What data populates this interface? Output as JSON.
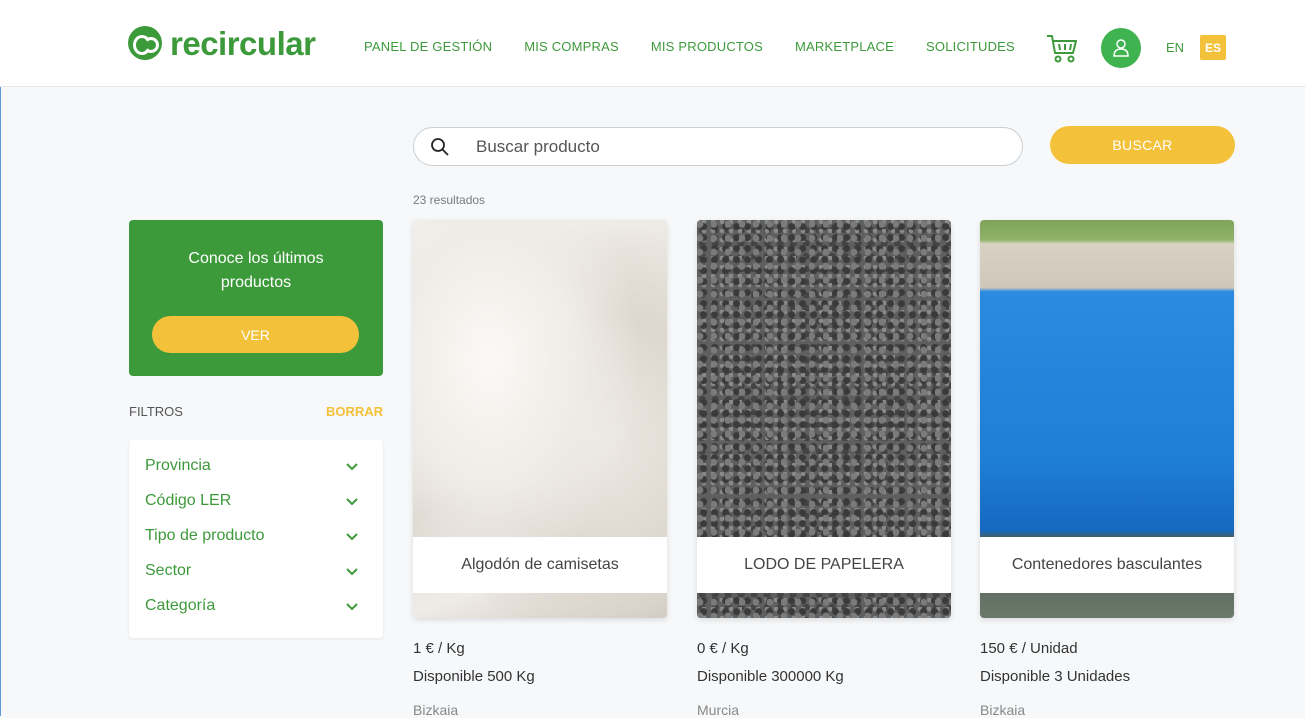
{
  "header": {
    "brand": "recircular",
    "nav": [
      "PANEL DE GESTIÓN",
      "MIS COMPRAS",
      "MIS PRODUCTOS",
      "MARKETPLACE",
      "SOLICITUDES"
    ],
    "lang_en": "EN",
    "lang_es": "ES"
  },
  "search": {
    "placeholder": "Buscar producto",
    "button": "BUSCAR"
  },
  "results": "23 resultados",
  "promo": {
    "text": "Conoce los últimos productos",
    "button": "VER"
  },
  "filters": {
    "label": "FILTROS",
    "clear": "BORRAR",
    "items": [
      "Provincia",
      "Código LER",
      "Tipo de producto",
      "Sector",
      "Categoría"
    ]
  },
  "products": [
    {
      "title": "Algodón de camisetas",
      "price": "1 € / Kg",
      "available": "Disponible 500 Kg",
      "location": "Bizkaia"
    },
    {
      "title": "LODO DE PAPELERA",
      "price": "0 € / Kg",
      "available": "Disponible 300000 Kg",
      "location": "Murcia"
    },
    {
      "title": "Contenedores basculantes",
      "price": "150 € / Unidad",
      "available": "Disponible 3 Unidades",
      "location": "Bizkaia"
    }
  ],
  "colors": {
    "brand_green": "#3d9a3b",
    "accent_yellow": "#f4c13a",
    "avatar_green": "#3fb34f"
  }
}
